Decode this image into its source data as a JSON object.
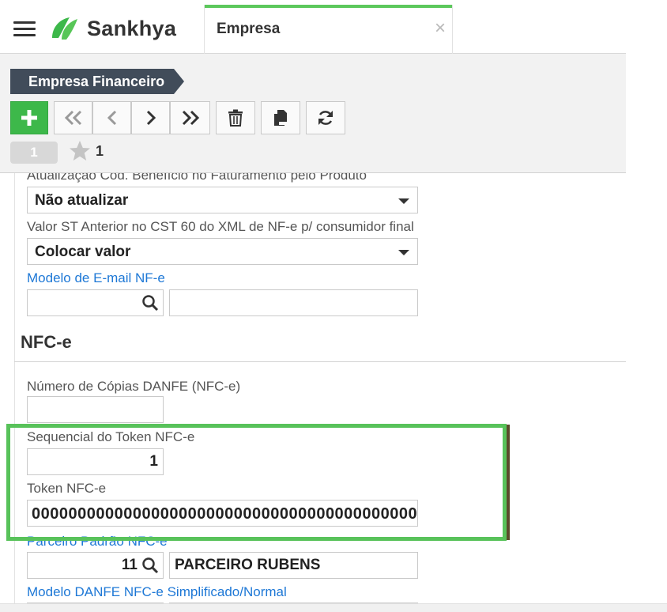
{
  "header": {
    "brand": "Sankhya",
    "tab_title": "Empresa",
    "tab_close": "×"
  },
  "colors": {
    "accent_green": "#3db84a",
    "breadcrumb_bg": "#414c5a",
    "link_blue": "#1e78d6",
    "highlight_green": "#58c25a"
  },
  "toolbar": {
    "breadcrumb": "Empresa Financeiro",
    "buttons": [
      {
        "name": "add-button",
        "icon": "plus-icon"
      },
      {
        "name": "first-record-button",
        "icon": "double-chevron-left-icon"
      },
      {
        "name": "previous-record-button",
        "icon": "chevron-left-icon"
      },
      {
        "name": "next-record-button",
        "icon": "chevron-right-icon"
      },
      {
        "name": "last-record-button",
        "icon": "double-chevron-right-icon"
      },
      {
        "name": "delete-button",
        "icon": "trash-icon"
      },
      {
        "name": "duplicate-button",
        "icon": "copy-icon"
      },
      {
        "name": "refresh-button",
        "icon": "refresh-icon"
      }
    ],
    "page_indicator": "1",
    "favorites_count": "1"
  },
  "form": {
    "field_atualizacao_label": "Atualização Cód. Benefício no Faturamento pelo Produto",
    "field_atualizacao_value": "Não atualizar",
    "field_valor_st_label": "Valor ST Anterior no CST 60 do XML de NF-e p/ consumidor final",
    "field_valor_st_value": "Colocar valor",
    "field_modelo_email_label": "Modelo de E-mail NF-e",
    "field_modelo_email_code": "",
    "field_modelo_email_desc": "",
    "section_nfce_title": "NFC-e",
    "field_copias_label": "Número de Cópias DANFE (NFC-e)",
    "field_copias_value": "",
    "field_seq_token_label": "Sequencial do Token NFC-e",
    "field_seq_token_value": "1",
    "field_token_label": "Token NFC-e",
    "field_token_value": "000000000000000000000000000000000000000000000000",
    "field_parceiro_label": "Parceiro Padrão NFC-e",
    "field_parceiro_code": "11",
    "field_parceiro_name": "PARCEIRO RUBENS",
    "field_modelo_danfe_label": "Modelo DANFE NFC-e Simplificado/Normal"
  }
}
